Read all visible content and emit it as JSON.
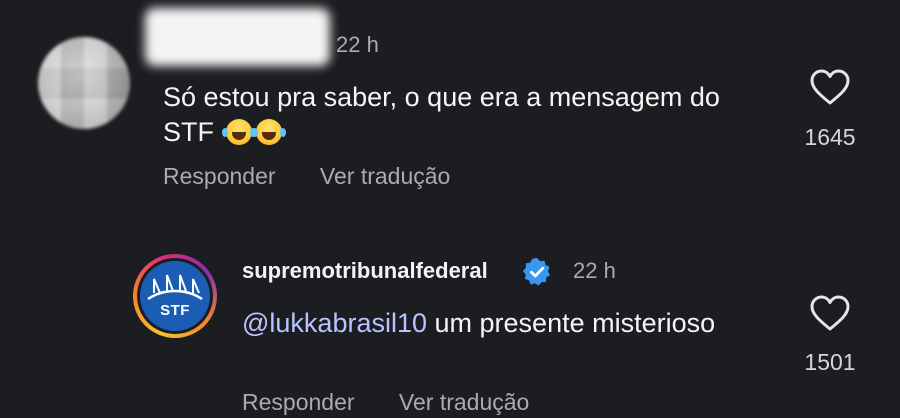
{
  "comments": [
    {
      "time": "22 h",
      "text": "Só estou pra saber, o que era a mensagem do STF",
      "emojis": [
        "😂",
        "😂"
      ],
      "actions": {
        "reply": "Responder",
        "translate": "Ver tradução"
      },
      "likes": "1645",
      "icons": {
        "like": "heart-outline-icon",
        "emoji": "face-with-tears-of-joy-icon"
      }
    },
    {
      "author": "supremotribunalfederal",
      "avatar_text": "STF",
      "verified": true,
      "time": "22 h",
      "mention": "@lukkabrasil10",
      "text": "um presente misterioso",
      "actions": {
        "reply": "Responder",
        "translate": "Ver tradução"
      },
      "likes": "1501",
      "icons": {
        "like": "heart-outline-icon",
        "verified": "verified-badge-icon"
      }
    }
  ],
  "colors": {
    "background": "#1b1d21",
    "text": "#f5f5f5",
    "muted": "#a9abaf",
    "mention": "#b8c4ff",
    "verified": "#3897f0",
    "stf_blue": "#1b5db5"
  }
}
